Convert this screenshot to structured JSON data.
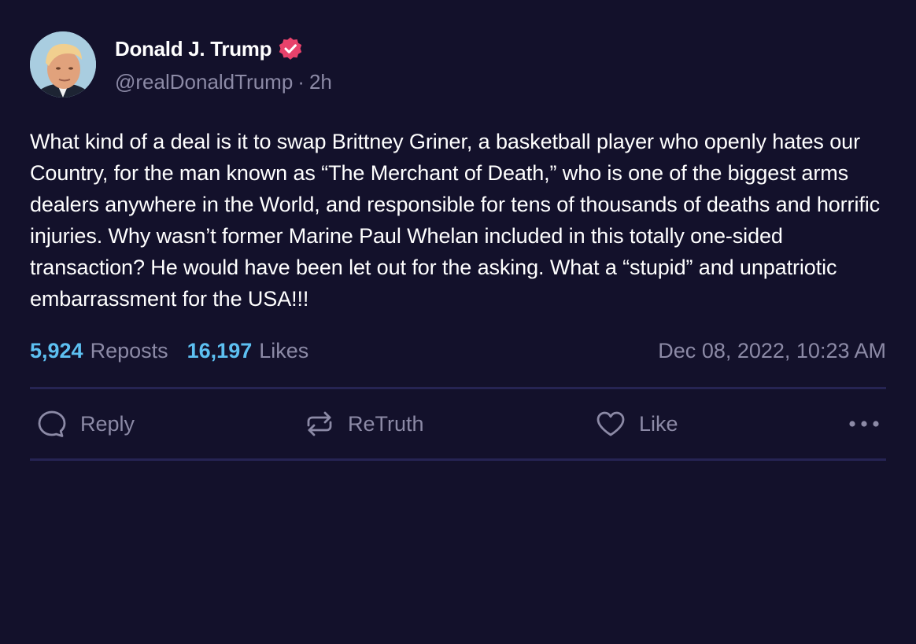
{
  "post": {
    "author": {
      "display_name": "Donald J. Trump",
      "handle": "@realDonaldTrump",
      "age": "2h",
      "separator": "·"
    },
    "text": "What kind of a deal is it to swap Brittney Griner, a basketball player who openly hates our Country, for the man known as “The Merchant of Death,” who is one of the biggest arms dealers anywhere in the World, and responsible for tens of thousands of deaths and horrific injuries. Why wasn’t former Marine Paul Whelan included in this totally one-sided transaction? He would have been let out for the asking. What a “stupid” and unpatriotic embarrassment for the USA!!!",
    "stats": {
      "reposts_count": "5,924",
      "reposts_label": "Reposts",
      "likes_count": "16,197",
      "likes_label": "Likes"
    },
    "timestamp": "Dec 08, 2022, 10:23 AM",
    "actions": {
      "reply_label": "Reply",
      "retruth_label": "ReTruth",
      "like_label": "Like"
    }
  },
  "icons": {
    "verified": "verified-badge-icon",
    "reply": "speech-bubble-icon",
    "retruth": "repost-arrows-icon",
    "like": "heart-icon",
    "more": "ellipsis-icon"
  },
  "colors": {
    "background": "#13112b",
    "accent": "#5dc0f1",
    "muted": "#8c8aa6",
    "verified": "#e8426b",
    "divider": "#262453"
  }
}
